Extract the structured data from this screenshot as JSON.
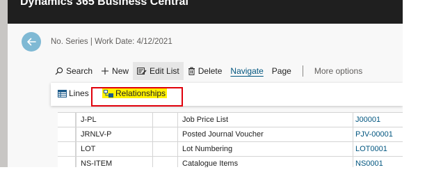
{
  "app": {
    "title": "Dynamics 365 Business Central"
  },
  "page": {
    "breadcrumb": "No. Series | Work Date: 4/12/2021"
  },
  "actions": [
    {
      "label": "Search",
      "icon": "search-icon"
    },
    {
      "label": "New",
      "icon": "plus-icon"
    },
    {
      "label": "Edit List",
      "icon": "edit-list-icon"
    },
    {
      "label": "Delete",
      "icon": "trash-icon"
    },
    {
      "label": "Navigate"
    },
    {
      "label": "Page"
    },
    {
      "label": "More options"
    }
  ],
  "navigate_menu": {
    "items": [
      {
        "label": "Lines",
        "icon": "lines-icon"
      },
      {
        "label": "Relationships",
        "icon": "relationships-icon"
      }
    ]
  },
  "table": {
    "rows": [
      {
        "code": "J-PL",
        "description": "Job Price List",
        "starting_no": "J00001"
      },
      {
        "code": "JRNLV-P",
        "description": "Posted Journal Voucher",
        "starting_no": "PJV-00001"
      },
      {
        "code": "LOT",
        "description": "Lot Numbering",
        "starting_no": "LOT0001"
      },
      {
        "code": "NS-ITEM",
        "description": "Catalogue Items",
        "starting_no": "NS0001"
      }
    ]
  },
  "colors": {
    "header_bg": "#1f1f1f",
    "back_button": "#7fb9d4",
    "link": "#00557f",
    "highlight": "#fff200",
    "annotation_border": "#e0000b"
  }
}
